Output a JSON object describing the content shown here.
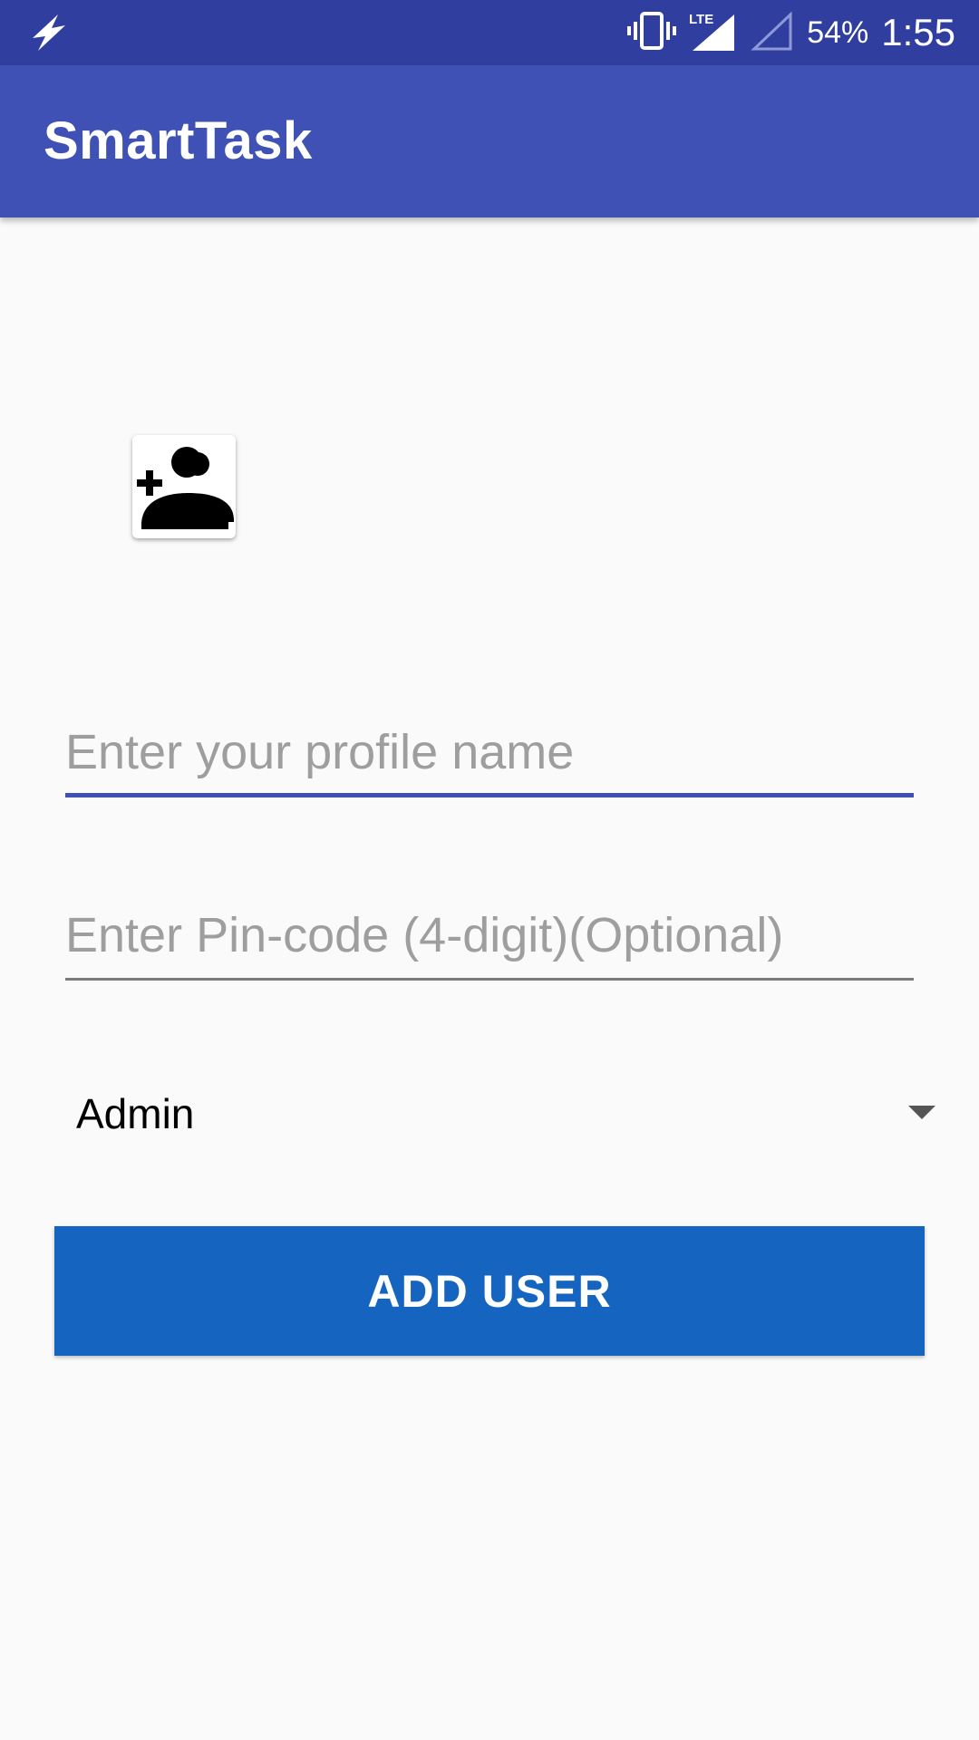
{
  "status_bar": {
    "battery_percent": "54%",
    "time": "1:55",
    "network_label": "LTE",
    "icons": [
      "flash-icon",
      "vibrate-icon",
      "lte-signal-icon",
      "signal-icon"
    ]
  },
  "app_bar": {
    "title": "SmartTask"
  },
  "form": {
    "avatar_icon": "add-user-icon",
    "profile_name": {
      "placeholder": "Enter your profile name",
      "value": ""
    },
    "pin_code": {
      "placeholder": "Enter Pin-code (4-digit)(Optional)",
      "value": ""
    },
    "role_select": {
      "selected": "Admin"
    },
    "submit_label": "ADD USER"
  },
  "colors": {
    "status_bar": "#303f9f",
    "app_bar": "#3f51b5",
    "button": "#1565c0",
    "focused_underline": "#3f51b5",
    "background": "#fafafa"
  }
}
